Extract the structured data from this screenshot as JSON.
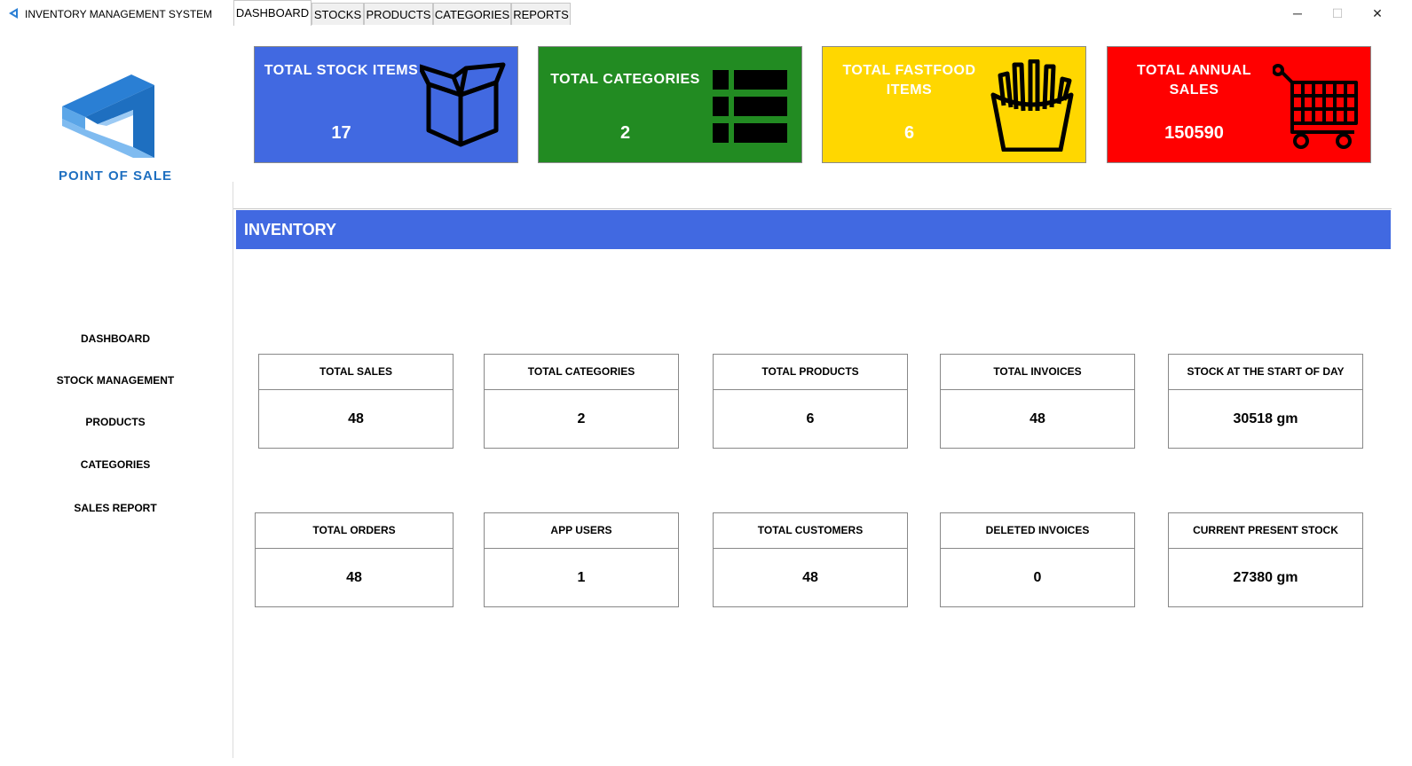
{
  "window": {
    "title": "INVENTORY MANAGEMENT SYSTEM",
    "minimize": "─",
    "maximize": "☐",
    "close": "✕"
  },
  "logo": {
    "text": "POINT OF SALE"
  },
  "sidebar": {
    "items": [
      {
        "label": "DASHBOARD"
      },
      {
        "label": "STOCK MANAGEMENT"
      },
      {
        "label": "PRODUCTS"
      },
      {
        "label": "CATEGORIES"
      },
      {
        "label": "SALES REPORT"
      }
    ]
  },
  "cards": [
    {
      "title": "TOTAL STOCK ITEMS",
      "value": "17",
      "color": "#4169e1",
      "icon": "box-icon"
    },
    {
      "title": "TOTAL CATEGORIES",
      "value": "2",
      "color": "#228b22",
      "icon": "list-icon"
    },
    {
      "title": "TOTAL FASTFOOD ITEMS",
      "value": "6",
      "color": "#ffd700",
      "icon": "fries-icon"
    },
    {
      "title": "TOTAL ANNUAL SALES",
      "value": "150590",
      "color": "#ff0000",
      "icon": "cart-icon"
    }
  ],
  "tabs": [
    {
      "label": "DASHBOARD",
      "active": true
    },
    {
      "label": "STOCKS"
    },
    {
      "label": "PRODUCTS"
    },
    {
      "label": "CATEGORIES"
    },
    {
      "label": "REPORTS"
    }
  ],
  "inventory": {
    "header": "INVENTORY",
    "header_color": "#4169e1",
    "row1": [
      {
        "label": "TOTAL SALES",
        "value": "48"
      },
      {
        "label": "TOTAL CATEGORIES",
        "value": "2"
      },
      {
        "label": "TOTAL PRODUCTS",
        "value": "6"
      },
      {
        "label": "TOTAL INVOICES",
        "value": "48"
      },
      {
        "label": "STOCK AT THE START OF DAY",
        "value": "30518 gm"
      }
    ],
    "row2": [
      {
        "label": "TOTAL ORDERS",
        "value": "48"
      },
      {
        "label": "APP USERS",
        "value": "1"
      },
      {
        "label": "TOTAL CUSTOMERS",
        "value": "48"
      },
      {
        "label": "DELETED INVOICES",
        "value": "0"
      },
      {
        "label": "CURRENT PRESENT STOCK",
        "value": "27380 gm"
      }
    ]
  }
}
